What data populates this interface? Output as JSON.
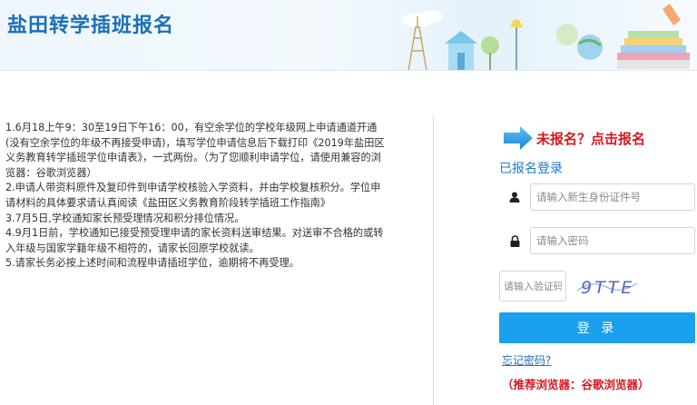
{
  "header": {
    "title": "盐田转学插班报名"
  },
  "notice": {
    "items": [
      "1.6月18上午9：30至19日下午16：00，有空余学位的学校年级网上申请通道开通(没有空余学位的年级不再接受申请)，填写学位申请信息后下载打印《2019年盐田区义务教育转学插班学位申请表》，一式两份。（为了您顺利申请学位，请使用兼容的浏览器：谷歌浏览器）",
      "2.申请人带资料原件及复印件到申请学校核验入学资料，并由学校复核积分。学位申请材料的具体要求请认真阅读《盐田区义务教育阶段转学插班工作指南》",
      "3.7月5日,学校通知家长预受理情况和积分排位情况。",
      "4.9月1日前，学校通知已接受预受理申请的家长资料送审结果。对送审不合格的或转入年级与国家学籍年级不相符的，请家长回原学校就读。",
      "5.请家长务必按上述时间和流程申请插班学位，逾期将不再受理。"
    ]
  },
  "login": {
    "register_link": "未报名？点击报名",
    "title": "已报名登录",
    "id_placeholder": "请输入新生身份证件号",
    "password_placeholder": "请输入密码",
    "captcha_placeholder": "请输入验证码",
    "captcha_code": "9TTE",
    "login_label": "登 录",
    "forgot_label": "忘记密码?",
    "browser_note": "（推荐浏览器：谷歌浏览器）"
  },
  "colors": {
    "brand_blue": "#1c6fb8",
    "button_blue": "#1aa0ec",
    "alert_red": "#d9161c"
  },
  "icons": {
    "user": "user-icon",
    "lock": "lock-icon",
    "arrow": "arrow-right-icon"
  }
}
